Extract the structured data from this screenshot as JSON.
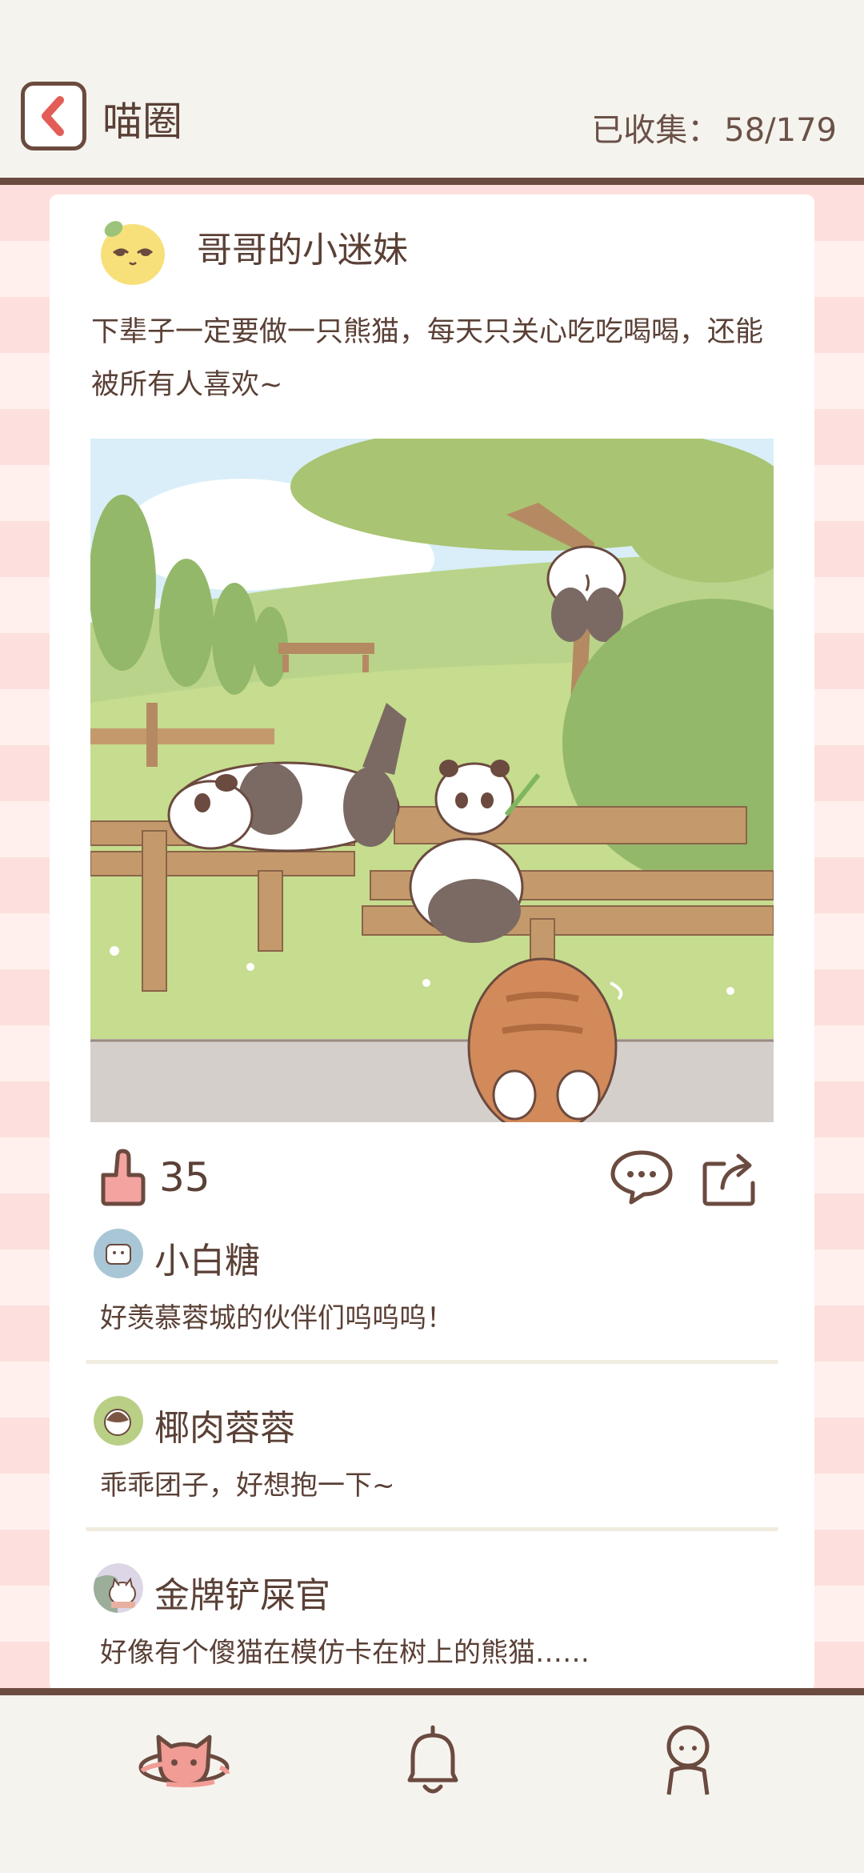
{
  "header": {
    "title": "喵圈",
    "collected_label": "已收集：",
    "collected_value": "58/179"
  },
  "post": {
    "author": "哥哥的小迷妹",
    "text": "下辈子一定要做一只熊猫，每天只关心吃吃喝喝，还能被所有人喜欢~",
    "likes": "35"
  },
  "comments": [
    {
      "name": "小白糖",
      "text": "好羡慕蓉城的伙伴们呜呜呜！",
      "avatar": "marshmallow-avatar"
    },
    {
      "name": "椰肉蓉蓉",
      "text": "乖乖团子，好想抱一下~",
      "avatar": "coconut-avatar"
    },
    {
      "name": "金牌铲屎官",
      "text": "好像有个傻猫在模仿卡在树上的熊猫……",
      "avatar": "cat-avatar"
    }
  ],
  "tabbar": {
    "items": [
      "cat-planet-icon",
      "bell-icon",
      "profile-icon"
    ]
  },
  "colors": {
    "brown": "#6b4a3f",
    "accent_red": "#e35d56",
    "stripe_pink": "#fde0dd",
    "background": "#f5f3ee"
  }
}
